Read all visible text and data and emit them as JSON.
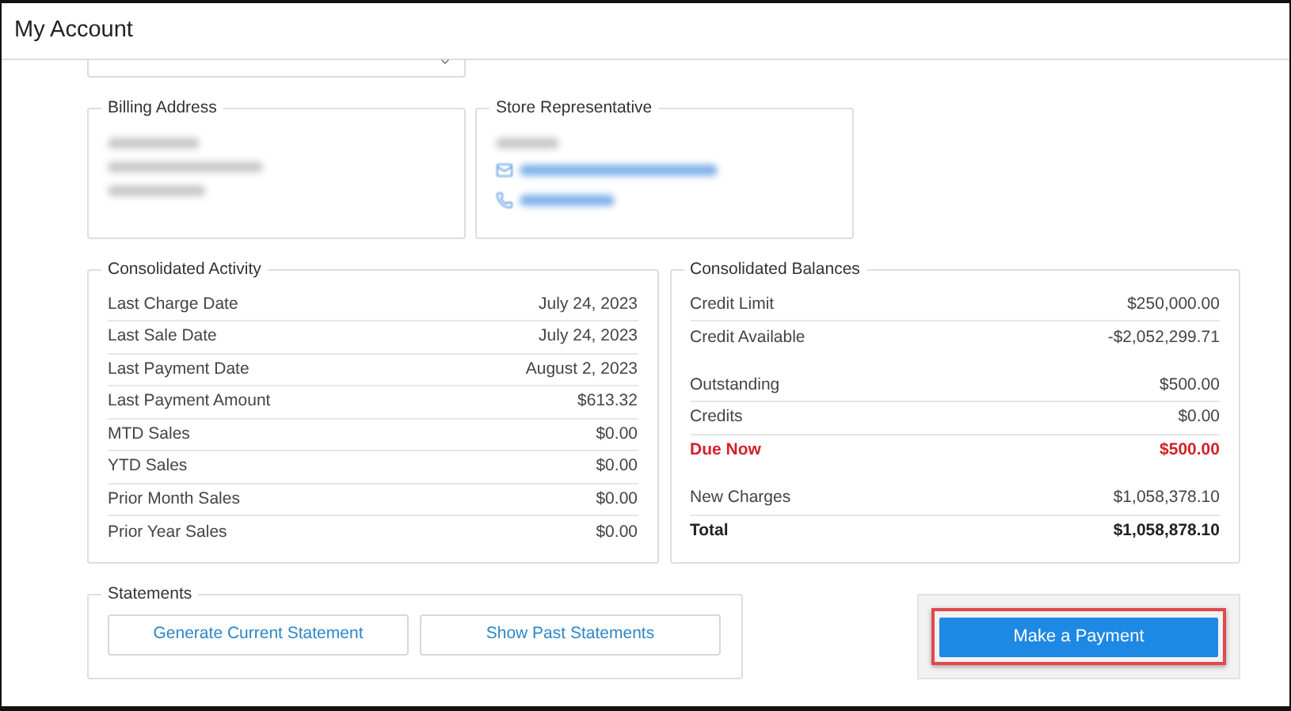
{
  "window": {
    "title": "My Account"
  },
  "billing_address": {
    "title": "Billing Address"
  },
  "store_representative": {
    "title": "Store Representative"
  },
  "activity": {
    "title": "Consolidated Activity",
    "rows": [
      {
        "label": "Last Charge Date",
        "value": "July 24, 2023"
      },
      {
        "label": "Last Sale Date",
        "value": "July 24, 2023"
      },
      {
        "label": "Last Payment Date",
        "value": "August 2, 2023"
      },
      {
        "label": "Last Payment Amount",
        "value": "$613.32"
      },
      {
        "label": "MTD Sales",
        "value": "$0.00"
      },
      {
        "label": "YTD Sales",
        "value": "$0.00"
      },
      {
        "label": "Prior Month Sales",
        "value": "$0.00"
      },
      {
        "label": "Prior Year Sales",
        "value": "$0.00"
      }
    ]
  },
  "balances": {
    "title": "Consolidated Balances",
    "groups": [
      [
        {
          "kind": "normal",
          "label": "Credit Limit",
          "value": "$250,000.00"
        },
        {
          "kind": "normal",
          "label": "Credit Available",
          "value": "-$2,052,299.71"
        }
      ],
      [
        {
          "kind": "normal",
          "label": "Outstanding",
          "value": "$500.00"
        },
        {
          "kind": "normal",
          "label": "Credits",
          "value": "$0.00"
        },
        {
          "kind": "due",
          "label": "Due Now",
          "value": "$500.00"
        }
      ],
      [
        {
          "kind": "normal",
          "label": "New Charges",
          "value": "$1,058,378.10"
        },
        {
          "kind": "total",
          "label": "Total",
          "value": "$1,058,878.10"
        }
      ]
    ]
  },
  "statements": {
    "title": "Statements",
    "buttons": [
      "Generate Current Statement",
      "Show Past Statements"
    ]
  },
  "payment": {
    "label": "Make a Payment",
    "highlighted": true
  }
}
